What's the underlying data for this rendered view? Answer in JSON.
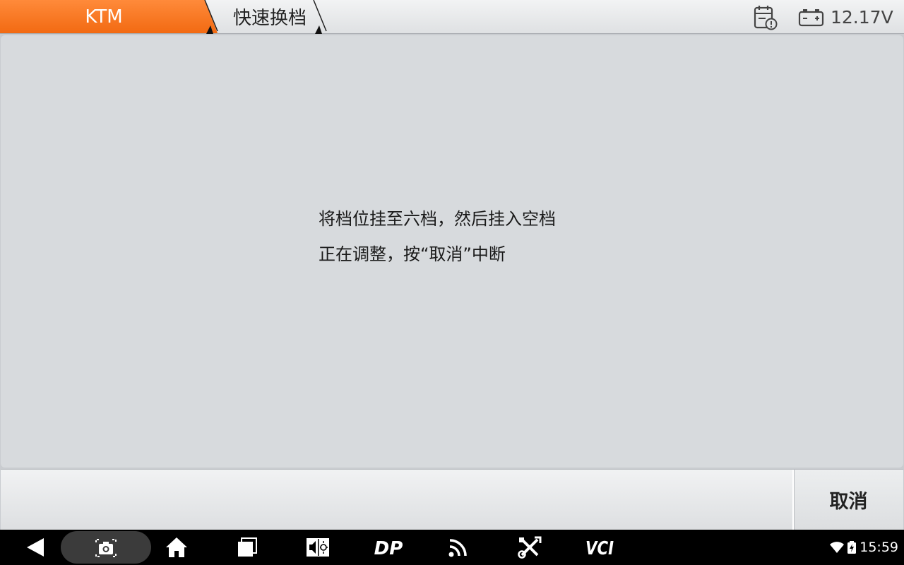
{
  "header": {
    "brand": "KTM",
    "page_title": "快速换档",
    "voltage": "12.17V",
    "icons": {
      "report": "report-clock-icon",
      "battery": "battery-icon"
    },
    "colors": {
      "accent": "#f26a12"
    }
  },
  "message": {
    "line1": "将档位挂至六档，然后挂入空档",
    "line2": "正在调整，按“取消”中断"
  },
  "actions": {
    "cancel_label": "取消"
  },
  "navbar": {
    "icons": [
      "back-icon",
      "screenshot-icon",
      "home-icon",
      "recent-apps-icon",
      "brightness-volume-icon",
      "dp-icon",
      "signal-icon",
      "tools-icon",
      "vci-icon"
    ],
    "dp_label": "DP",
    "vci_label": "VCI",
    "time": "15:59"
  }
}
